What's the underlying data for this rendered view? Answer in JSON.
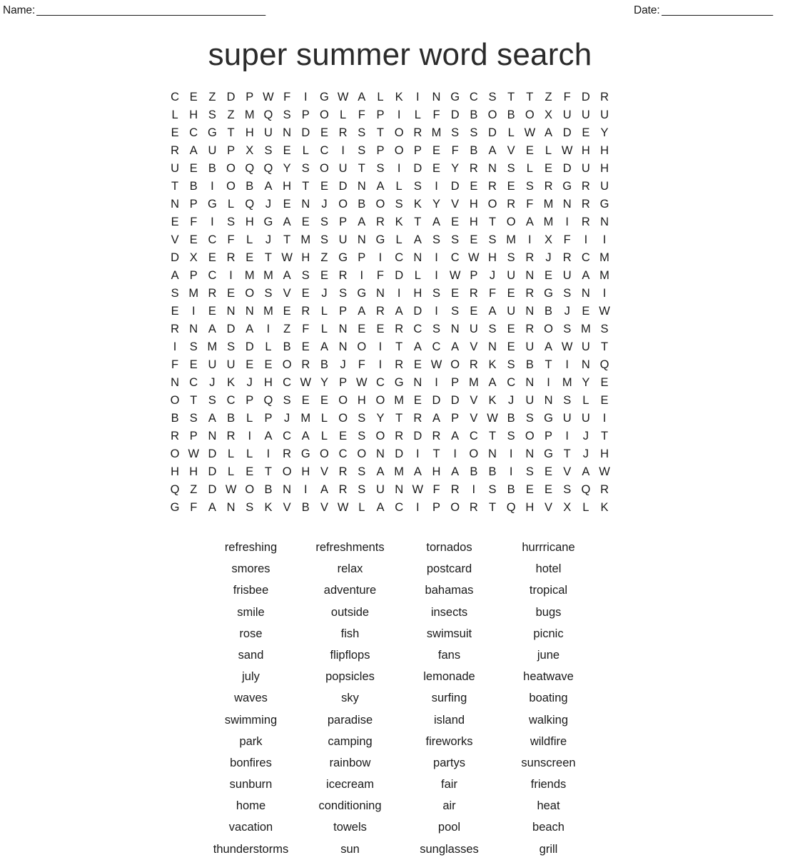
{
  "header": {
    "name_label": "Name:",
    "name_rule": "_______________________________________",
    "date_label": "Date:",
    "date_rule": "___________________"
  },
  "title": "super summer word search",
  "grid": {
    "rows": 24,
    "cols": 22,
    "letters": [
      [
        "C",
        "E",
        "Z",
        "D",
        "P",
        "W",
        "F",
        "I",
        "G",
        "W",
        "A",
        "L",
        "K",
        "I",
        "N",
        "G",
        "C",
        "S",
        "T",
        "T",
        "Z",
        "F",
        "D",
        "R"
      ],
      [
        "L",
        "H",
        "S",
        "Z",
        "M",
        "Q",
        "S",
        "P",
        "O",
        "L",
        "F",
        "P",
        "I",
        "L",
        "F",
        "D",
        "B",
        "O",
        "B",
        "O",
        "X",
        "U",
        "U",
        "U"
      ],
      [
        "E",
        "C",
        "G",
        "T",
        "H",
        "U",
        "N",
        "D",
        "E",
        "R",
        "S",
        "T",
        "O",
        "R",
        "M",
        "S",
        "S",
        "D",
        "L",
        "W",
        "A",
        "D",
        "E",
        "Y"
      ],
      [
        "R",
        "A",
        "U",
        "P",
        "X",
        "S",
        "E",
        "L",
        "C",
        "I",
        "S",
        "P",
        "O",
        "P",
        "E",
        "F",
        "B",
        "A",
        "V",
        "E",
        "L",
        "W",
        "H",
        "H"
      ],
      [
        "U",
        "E",
        "B",
        "O",
        "Q",
        "Q",
        "Y",
        "S",
        "O",
        "U",
        "T",
        "S",
        "I",
        "D",
        "E",
        "Y",
        "R",
        "N",
        "S",
        "L",
        "E",
        "D",
        "U",
        "H"
      ],
      [
        "T",
        "B",
        "I",
        "O",
        "B",
        "A",
        "H",
        "T",
        "E",
        "D",
        "N",
        "A",
        "L",
        "S",
        "I",
        "D",
        "E",
        "R",
        "E",
        "S",
        "R",
        "G",
        "R",
        "U"
      ],
      [
        "N",
        "P",
        "G",
        "L",
        "Q",
        "J",
        "E",
        "N",
        "J",
        "O",
        "B",
        "O",
        "S",
        "K",
        "Y",
        "V",
        "H",
        "O",
        "R",
        "F",
        "M",
        "N",
        "R",
        "G"
      ],
      [
        "E",
        "F",
        "I",
        "S",
        "H",
        "G",
        "A",
        "E",
        "S",
        "P",
        "A",
        "R",
        "K",
        "T",
        "A",
        "E",
        "H",
        "T",
        "O",
        "A",
        "M",
        "I",
        "R",
        "N"
      ],
      [
        "V",
        "E",
        "C",
        "F",
        "L",
        "J",
        "T",
        "M",
        "S",
        "U",
        "N",
        "G",
        "L",
        "A",
        "S",
        "S",
        "E",
        "S",
        "M",
        "I",
        "X",
        "F",
        "I",
        "I"
      ],
      [
        "D",
        "X",
        "E",
        "R",
        "E",
        "T",
        "W",
        "H",
        "Z",
        "G",
        "P",
        "I",
        "C",
        "N",
        "I",
        "C",
        "W",
        "H",
        "S",
        "R",
        "J",
        "R",
        "C",
        "M"
      ],
      [
        "A",
        "P",
        "C",
        "I",
        "M",
        "M",
        "A",
        "S",
        "E",
        "R",
        "I",
        "F",
        "D",
        "L",
        "I",
        "W",
        "P",
        "J",
        "U",
        "N",
        "E",
        "U",
        "A",
        "M"
      ],
      [
        "S",
        "M",
        "R",
        "E",
        "O",
        "S",
        "V",
        "E",
        "J",
        "S",
        "G",
        "N",
        "I",
        "H",
        "S",
        "E",
        "R",
        "F",
        "E",
        "R",
        "G",
        "S",
        "N",
        "I"
      ],
      [
        "E",
        "I",
        "E",
        "N",
        "N",
        "M",
        "E",
        "R",
        "L",
        "P",
        "A",
        "R",
        "A",
        "D",
        "I",
        "S",
        "E",
        "A",
        "U",
        "N",
        "B",
        "J",
        "E",
        "W"
      ],
      [
        "R",
        "N",
        "A",
        "D",
        "A",
        "I",
        "Z",
        "F",
        "L",
        "N",
        "E",
        "E",
        "R",
        "C",
        "S",
        "N",
        "U",
        "S",
        "E",
        "R",
        "O",
        "S",
        "M",
        "S"
      ],
      [
        "I",
        "S",
        "M",
        "S",
        "D",
        "L",
        "B",
        "E",
        "A",
        "N",
        "O",
        "I",
        "T",
        "A",
        "C",
        "A",
        "V",
        "N",
        "E",
        "U",
        "A",
        "W",
        "U",
        "T"
      ],
      [
        "F",
        "E",
        "U",
        "U",
        "E",
        "E",
        "O",
        "R",
        "B",
        "J",
        "F",
        "I",
        "R",
        "E",
        "W",
        "O",
        "R",
        "K",
        "S",
        "B",
        "T",
        "I",
        "N",
        "Q"
      ],
      [
        "N",
        "C",
        "J",
        "K",
        "J",
        "H",
        "C",
        "W",
        "Y",
        "P",
        "W",
        "C",
        "G",
        "N",
        "I",
        "P",
        "M",
        "A",
        "C",
        "N",
        "I",
        "M",
        "Y",
        "E"
      ],
      [
        "O",
        "T",
        "S",
        "C",
        "P",
        "Q",
        "S",
        "E",
        "E",
        "O",
        "H",
        "O",
        "M",
        "E",
        "D",
        "D",
        "V",
        "K",
        "J",
        "U",
        "N",
        "S",
        "L",
        "E"
      ],
      [
        "B",
        "S",
        "A",
        "B",
        "L",
        "P",
        "J",
        "M",
        "L",
        "O",
        "S",
        "Y",
        "T",
        "R",
        "A",
        "P",
        "V",
        "W",
        "B",
        "S",
        "G",
        "U",
        "U",
        "I"
      ],
      [
        "R",
        "P",
        "N",
        "R",
        "I",
        "A",
        "C",
        "A",
        "L",
        "E",
        "S",
        "O",
        "R",
        "D",
        "R",
        "A",
        "C",
        "T",
        "S",
        "O",
        "P",
        "I",
        "J",
        "T"
      ],
      [
        "O",
        "W",
        "D",
        "L",
        "L",
        "I",
        "R",
        "G",
        "O",
        "C",
        "O",
        "N",
        "D",
        "I",
        "T",
        "I",
        "O",
        "N",
        "I",
        "N",
        "G",
        "T",
        "J",
        "H"
      ],
      [
        "H",
        "H",
        "D",
        "L",
        "E",
        "T",
        "O",
        "H",
        "V",
        "R",
        "S",
        "A",
        "M",
        "A",
        "H",
        "A",
        "B",
        "B",
        "I",
        "S",
        "E",
        "V",
        "A",
        "W"
      ],
      [
        "Q",
        "Z",
        "D",
        "W",
        "O",
        "B",
        "N",
        "I",
        "A",
        "R",
        "S",
        "U",
        "N",
        "W",
        "F",
        "R",
        "I",
        "S",
        "B",
        "E",
        "E",
        "S",
        "Q",
        "R"
      ],
      [
        "G",
        "F",
        "A",
        "N",
        "S",
        "K",
        "V",
        "B",
        "V",
        "W",
        "L",
        "A",
        "C",
        "I",
        "P",
        "O",
        "R",
        "T",
        "Q",
        "H",
        "V",
        "X",
        "L",
        "K"
      ]
    ]
  },
  "word_list": {
    "columns": 4,
    "rows": [
      [
        "refreshing",
        "refreshments",
        "tornados",
        "hurrricane"
      ],
      [
        "smores",
        "relax",
        "postcard",
        "hotel"
      ],
      [
        "frisbee",
        "adventure",
        "bahamas",
        "tropical"
      ],
      [
        "smile",
        "outside",
        "insects",
        "bugs"
      ],
      [
        "rose",
        "fish",
        "swimsuit",
        "picnic"
      ],
      [
        "sand",
        "flipflops",
        "fans",
        "june"
      ],
      [
        "july",
        "popsicles",
        "lemonade",
        "heatwave"
      ],
      [
        "waves",
        "sky",
        "surfing",
        "boating"
      ],
      [
        "swimming",
        "paradise",
        "island",
        "walking"
      ],
      [
        "park",
        "camping",
        "fireworks",
        "wildfire"
      ],
      [
        "bonfires",
        "rainbow",
        "partys",
        "sunscreen"
      ],
      [
        "sunburn",
        "icecream",
        "fair",
        "friends"
      ],
      [
        "home",
        "conditioning",
        "air",
        "heat"
      ],
      [
        "vacation",
        "towels",
        "pool",
        "beach"
      ],
      [
        "thunderstorms",
        "sun",
        "sunglasses",
        "grill"
      ]
    ]
  }
}
